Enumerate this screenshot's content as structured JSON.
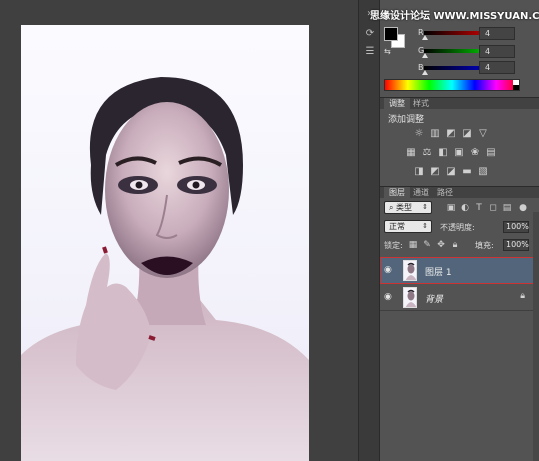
{
  "watermark": "思缘设计论坛 WWW.MISSYUAN.COM",
  "colors": {
    "foreground": "#000000",
    "background": "#ffffff",
    "selected_layer": "#53657b",
    "highlight_outline": "#cc3333"
  },
  "color_panel": {
    "channels": [
      {
        "label": "R",
        "value": "4"
      },
      {
        "label": "G",
        "value": "4"
      },
      {
        "label": "B",
        "value": "4"
      }
    ]
  },
  "tabs_top": [
    {
      "label": "调整",
      "active": true
    },
    {
      "label": "样式",
      "active": false
    }
  ],
  "adjustments": {
    "title": "添加调整",
    "row1_icons": [
      "brightness-icon",
      "levels-icon",
      "curves-icon",
      "exposure-icon",
      "vibrance-icon"
    ],
    "row2_icons": [
      "hue-icon",
      "color-balance-icon",
      "black-white-icon",
      "photo-filter-icon",
      "channel-mixer-icon",
      "color-lookup-icon"
    ],
    "row3_icons": [
      "invert-icon",
      "posterize-icon",
      "threshold-icon",
      "gradient-map-icon",
      "selective-color-icon"
    ]
  },
  "tabs_layers": [
    {
      "label": "图层",
      "active": true
    },
    {
      "label": "通道",
      "active": false
    },
    {
      "label": "路径",
      "active": false
    }
  ],
  "layers_panel": {
    "filter_select": "类型",
    "blend_mode": "正常",
    "opacity_label": "不透明度:",
    "opacity_value": "100%",
    "lock_label": "锁定:",
    "fill_label": "填充:",
    "fill_value": "100%"
  },
  "layers": [
    {
      "name": "图层 1",
      "selected": true,
      "locked": false
    },
    {
      "name": "背景",
      "selected": false,
      "locked": true
    }
  ]
}
